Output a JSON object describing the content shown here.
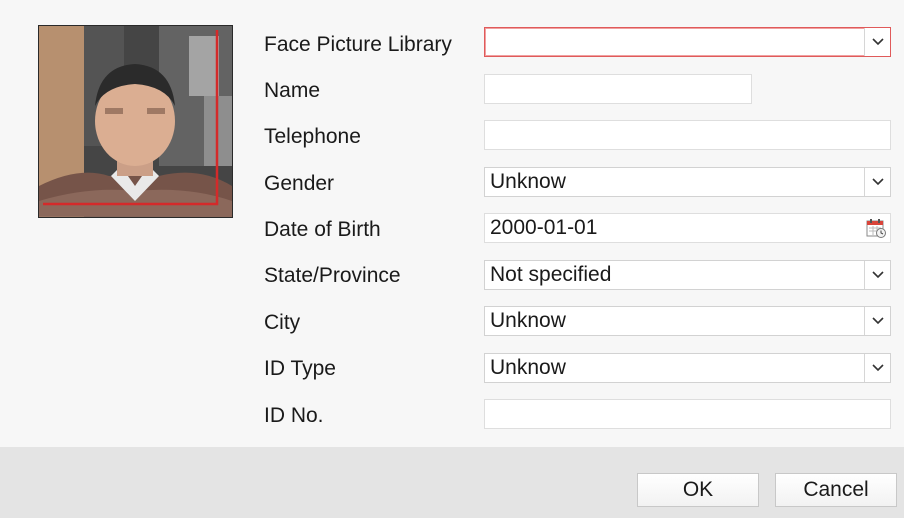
{
  "form": {
    "face_picture_library": {
      "label": "Face Picture Library",
      "value": ""
    },
    "name": {
      "label": "Name",
      "value": ""
    },
    "telephone": {
      "label": "Telephone",
      "value": ""
    },
    "gender": {
      "label": "Gender",
      "value": "Unknow"
    },
    "date_of_birth": {
      "label": "Date of Birth",
      "value": "2000-01-01"
    },
    "state_province": {
      "label": "State/Province",
      "value": "Not specified"
    },
    "city": {
      "label": "City",
      "value": "Unknow"
    },
    "id_type": {
      "label": "ID Type",
      "value": "Unknow"
    },
    "id_no": {
      "label": "ID No.",
      "value": ""
    }
  },
  "buttons": {
    "ok": "OK",
    "cancel": "Cancel"
  },
  "colors": {
    "highlight_border": "#e05a5a",
    "face_frame": "#d42a2a",
    "footer_bg": "#e4e4e4"
  },
  "icons": {
    "dropdown": "chevron-down-icon",
    "calendar": "calendar-icon"
  }
}
